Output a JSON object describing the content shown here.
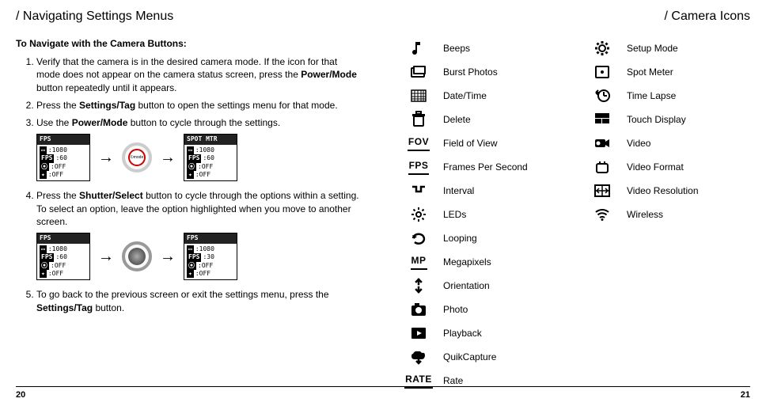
{
  "left": {
    "header": "/ Navigating Settings Menus",
    "section_title": "To Navigate with the Camera Buttons:",
    "steps": {
      "s1_a": "Verify that the camera is in the desired camera mode. If the icon for that mode does not appear on the camera status screen, press the ",
      "s1_b": "Power/Mode",
      "s1_c": " button repeatedly until it appears.",
      "s2_a": "Press the ",
      "s2_b": "Settings/Tag",
      "s2_c": " button to open the settings menu for that mode.",
      "s3_a": "Use the ",
      "s3_b": "Power/Mode",
      "s3_c": " button to cycle through the settings.",
      "s4_a": "Press the ",
      "s4_b": "Shutter/Select",
      "s4_c": " button to cycle through the options within a setting. To select an option, leave the option highlighted when you move to another screen.",
      "s5_a": "To go back to the previous screen or exit the settings menu, press the ",
      "s5_b": "Settings/Tag",
      "s5_c": " button."
    },
    "fig": {
      "fps_label": "FPS",
      "spot_label": "SPOT MTR",
      "res1080": ":1080",
      "fps60": ":60",
      "fps30": ":30",
      "off": ":OFF",
      "mode_text": "mode",
      "arrow": "→"
    }
  },
  "right": {
    "header": "/ Camera Icons",
    "col1": [
      {
        "name": "Beeps",
        "icon": "beeps"
      },
      {
        "name": "Burst Photos",
        "icon": "burst"
      },
      {
        "name": "Date/Time",
        "icon": "datetime"
      },
      {
        "name": "Delete",
        "icon": "delete"
      },
      {
        "name": "Field of View",
        "icon": "fov",
        "text": "FOV"
      },
      {
        "name": "Frames Per Second",
        "icon": "fps",
        "text": "FPS"
      },
      {
        "name": "Interval",
        "icon": "interval"
      },
      {
        "name": "LEDs",
        "icon": "leds"
      },
      {
        "name": "Looping",
        "icon": "looping"
      },
      {
        "name": "Megapixels",
        "icon": "mp",
        "text": "MP"
      },
      {
        "name": "Orientation",
        "icon": "orientation"
      },
      {
        "name": "Photo",
        "icon": "photo"
      },
      {
        "name": "Playback",
        "icon": "playback"
      },
      {
        "name": "QuikCapture",
        "icon": "quikcapture"
      },
      {
        "name": "Rate",
        "icon": "rate",
        "text": "RATE"
      }
    ],
    "col2": [
      {
        "name": "Setup Mode",
        "icon": "setup"
      },
      {
        "name": "Spot Meter",
        "icon": "spotmeter"
      },
      {
        "name": "Time Lapse",
        "icon": "timelapse"
      },
      {
        "name": "Touch Display",
        "icon": "touchdisplay"
      },
      {
        "name": "Video",
        "icon": "video"
      },
      {
        "name": "Video Format",
        "icon": "videoformat"
      },
      {
        "name": "Video Resolution",
        "icon": "videores"
      },
      {
        "name": "Wireless",
        "icon": "wireless"
      }
    ]
  },
  "page_left": "20",
  "page_right": "21"
}
